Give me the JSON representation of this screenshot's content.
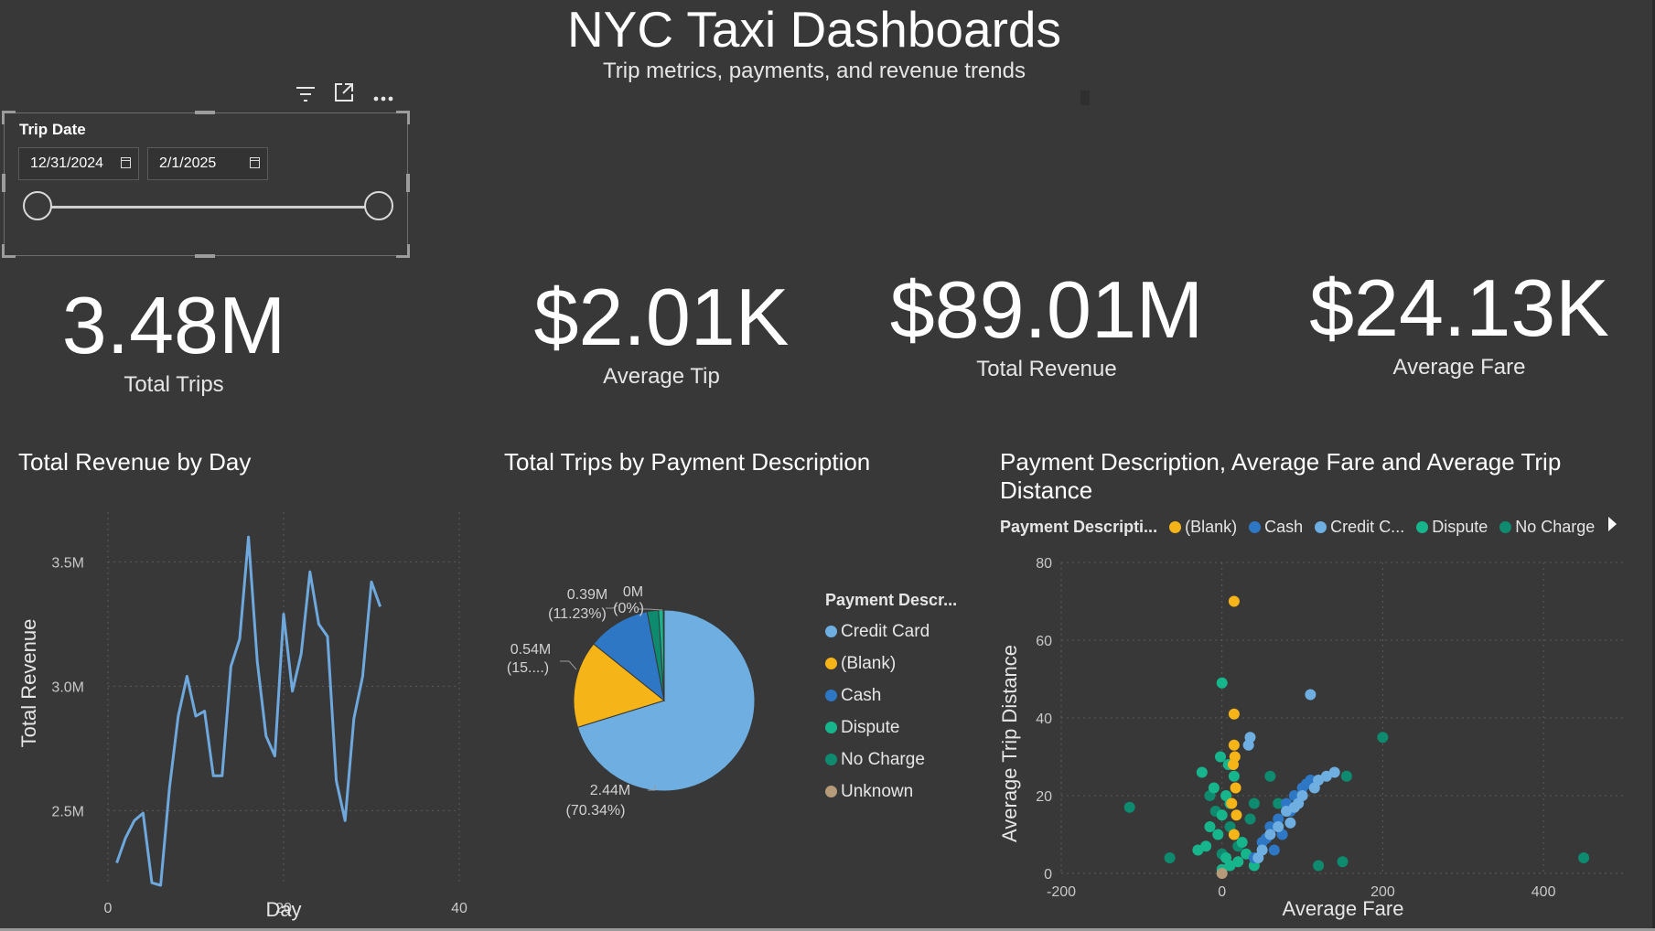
{
  "header": {
    "title": "NYC Taxi Dashboards",
    "subtitle": "Trip metrics, payments, and revenue trends"
  },
  "slicer": {
    "title": "Trip Date",
    "start_date": "12/31/2024",
    "end_date": "2/1/2025",
    "range_fraction": [
      0,
      1
    ],
    "icons": [
      "filter-icon",
      "focus-mode-icon",
      "more-options-icon"
    ]
  },
  "kpis": [
    {
      "value": "3.48M",
      "label": "Total Trips"
    },
    {
      "value": "$2.01K",
      "label": "Average Tip"
    },
    {
      "value": "$89.01M",
      "label": "Total Revenue"
    },
    {
      "value": "$24.13K",
      "label": "Average Fare"
    }
  ],
  "line_chart": {
    "title": "Total Revenue by Day",
    "x_label": "Day",
    "y_label": "Total Revenue",
    "x_ticks": [
      "0",
      "20",
      "40"
    ],
    "y_ticks": [
      "2.5M",
      "3.0M",
      "3.5M"
    ]
  },
  "pie_chart": {
    "title": "Total Trips by Payment Description",
    "legend_title": "Payment Descr...",
    "legend": [
      "Credit Card",
      "(Blank)",
      "Cash",
      "Dispute",
      "No Charge",
      "Unknown"
    ],
    "labels": [
      {
        "line1": "2.44M",
        "line2": "(70.34%)"
      },
      {
        "line1": "0.54M",
        "line2": "(15....)"
      },
      {
        "line1": "0.39M",
        "line2": "(11.23%)"
      },
      {
        "line1": "0M",
        "line2": "(0%)"
      }
    ]
  },
  "scatter_chart": {
    "title_line1": "Payment Description, Average Fare and Average Trip",
    "title_line2": "Distance",
    "legend_title": "Payment Descripti...",
    "legend": [
      "(Blank)",
      "Cash",
      "Credit C...",
      "Dispute",
      "No Charge"
    ],
    "x_label": "Average Fare",
    "y_label": "Average Trip Distance",
    "x_ticks": [
      "-200",
      "0",
      "200",
      "400"
    ],
    "y_ticks": [
      "0",
      "20",
      "40",
      "60",
      "80"
    ]
  },
  "colors": {
    "background": "#383838",
    "line": "#6ea8dc",
    "credit_card": "#6eaee0",
    "blank": "#f5b417",
    "cash": "#2e77c4",
    "dispute": "#17b58c",
    "no_charge": "#0e8a6e",
    "unknown": "#b59b7a"
  },
  "chart_data": [
    {
      "type": "line",
      "title": "Total Revenue by Day",
      "xlabel": "Day",
      "ylabel": "Total Revenue",
      "xlim": [
        0,
        40
      ],
      "ylim": [
        2.2,
        3.7
      ],
      "series": [
        {
          "x": [
            1,
            2,
            3,
            4,
            5,
            6,
            7,
            8,
            9,
            10,
            11,
            12,
            13,
            14,
            15,
            16,
            17,
            18,
            19,
            20,
            21,
            22,
            23,
            24,
            25,
            26,
            27,
            28,
            29,
            30,
            31
          ],
          "values": [
            2.29,
            2.39,
            2.46,
            2.49,
            2.21,
            2.2,
            2.59,
            2.88,
            3.04,
            2.88,
            2.9,
            2.64,
            2.64,
            3.08,
            3.19,
            3.6,
            3.1,
            2.8,
            2.72,
            3.29,
            2.98,
            3.13,
            3.46,
            3.25,
            3.2,
            2.62,
            2.46,
            2.87,
            3.04,
            3.42,
            3.32
          ]
        }
      ]
    },
    {
      "type": "pie",
      "title": "Total Trips by Payment Description",
      "categories": [
        "Credit Card",
        "(Blank)",
        "Cash",
        "No Charge",
        "Dispute",
        "Unknown"
      ],
      "values": [
        2.44,
        0.54,
        0.39,
        0.07,
        0.03,
        0.005
      ],
      "percent_labels": [
        "70.34%",
        "15....",
        "11.23%",
        "",
        "0%",
        ""
      ]
    },
    {
      "type": "scatter",
      "title": "Payment Description, Average Fare and Average Trip Distance",
      "xlabel": "Average Fare",
      "ylabel": "Average Trip Distance",
      "xlim": [
        -200,
        500
      ],
      "ylim": [
        0,
        80
      ],
      "series": [
        {
          "name": "(Blank)",
          "points": [
            [
              15,
              70
            ],
            [
              15,
              41
            ],
            [
              15,
              33
            ],
            [
              16,
              30
            ],
            [
              14,
              28
            ],
            [
              17,
              22
            ],
            [
              12,
              18
            ],
            [
              18,
              15
            ],
            [
              15,
              10
            ]
          ]
        },
        {
          "name": "Cash",
          "points": [
            [
              50,
              8
            ],
            [
              60,
              12
            ],
            [
              70,
              14
            ],
            [
              80,
              18
            ],
            [
              90,
              20
            ],
            [
              100,
              22
            ],
            [
              110,
              24
            ],
            [
              85,
              16
            ],
            [
              75,
              10
            ],
            [
              95,
              19
            ],
            [
              65,
              6
            ],
            [
              105,
              23
            ],
            [
              40,
              4
            ],
            [
              55,
              9
            ]
          ]
        },
        {
          "name": "Credit Card",
          "points": [
            [
              110,
              46
            ],
            [
              35,
              35
            ],
            [
              33,
              33
            ],
            [
              60,
              10
            ],
            [
              70,
              12
            ],
            [
              80,
              16
            ],
            [
              90,
              17
            ],
            [
              100,
              20
            ],
            [
              115,
              22
            ],
            [
              120,
              24
            ],
            [
              130,
              25
            ],
            [
              140,
              26
            ],
            [
              50,
              6
            ],
            [
              45,
              4
            ],
            [
              85,
              13
            ],
            [
              95,
              18
            ]
          ]
        },
        {
          "name": "Dispute",
          "points": [
            [
              0,
              49
            ],
            [
              -25,
              26
            ],
            [
              -10,
              22
            ],
            [
              5,
              20
            ],
            [
              10,
              18
            ],
            [
              15,
              25
            ],
            [
              0,
              15
            ],
            [
              -15,
              12
            ],
            [
              -20,
              7
            ],
            [
              -30,
              6
            ],
            [
              5,
              4
            ],
            [
              20,
              3
            ],
            [
              10,
              2
            ],
            [
              0,
              1
            ],
            [
              -5,
              10
            ],
            [
              25,
              8
            ],
            [
              30,
              5
            ],
            [
              40,
              2
            ],
            [
              -2,
              30
            ],
            [
              8,
              28
            ]
          ]
        },
        {
          "name": "No Charge",
          "points": [
            [
              -115,
              17
            ],
            [
              200,
              35
            ],
            [
              155,
              25
            ],
            [
              450,
              4
            ],
            [
              -65,
              4
            ],
            [
              -15,
              20
            ],
            [
              40,
              18
            ],
            [
              60,
              25
            ],
            [
              70,
              18
            ],
            [
              120,
              2
            ],
            [
              150,
              3
            ],
            [
              0,
              5
            ],
            [
              10,
              12
            ],
            [
              20,
              7
            ],
            [
              -8,
              16
            ],
            [
              35,
              14
            ]
          ]
        },
        {
          "name": "Unknown",
          "points": [
            [
              0,
              0
            ]
          ]
        }
      ]
    }
  ]
}
